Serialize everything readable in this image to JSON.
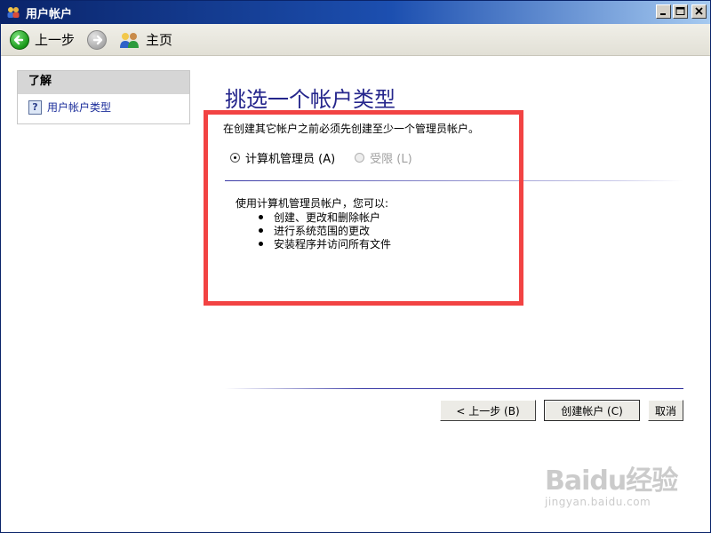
{
  "window": {
    "title": "用户帐户"
  },
  "toolbar": {
    "back_label": "上一步",
    "home_label": "主页"
  },
  "side_panel": {
    "header": "了解",
    "link": "用户帐户类型"
  },
  "main": {
    "title": "挑选一个帐户类型",
    "intro": "在创建其它帐户之前必须先创建至少一个管理员帐户。",
    "options": [
      {
        "label": "计算机管理员 (A)",
        "checked": true,
        "enabled": true
      },
      {
        "label": "受限 (L)",
        "checked": false,
        "enabled": false
      }
    ],
    "description": "使用计算机管理员帐户，您可以:",
    "bullets": [
      "创建、更改和删除帐户",
      "进行系统范围的更改",
      "安装程序并访问所有文件"
    ]
  },
  "buttons": {
    "back": "< 上一步 (B)",
    "create": "创建帐户 (C)",
    "cancel": "取消"
  },
  "watermark": {
    "main": "Baidu经验",
    "sub": "jingyan.baidu.com"
  },
  "colors": {
    "title_blue": "#25268c",
    "highlight_red": "#f24343",
    "titlebar_start": "#0a246a"
  },
  "icons": {
    "title": "users-icon",
    "back": "back-arrow-icon",
    "forward": "forward-arrow-icon",
    "home": "users-home-icon",
    "help": "help-icon"
  }
}
